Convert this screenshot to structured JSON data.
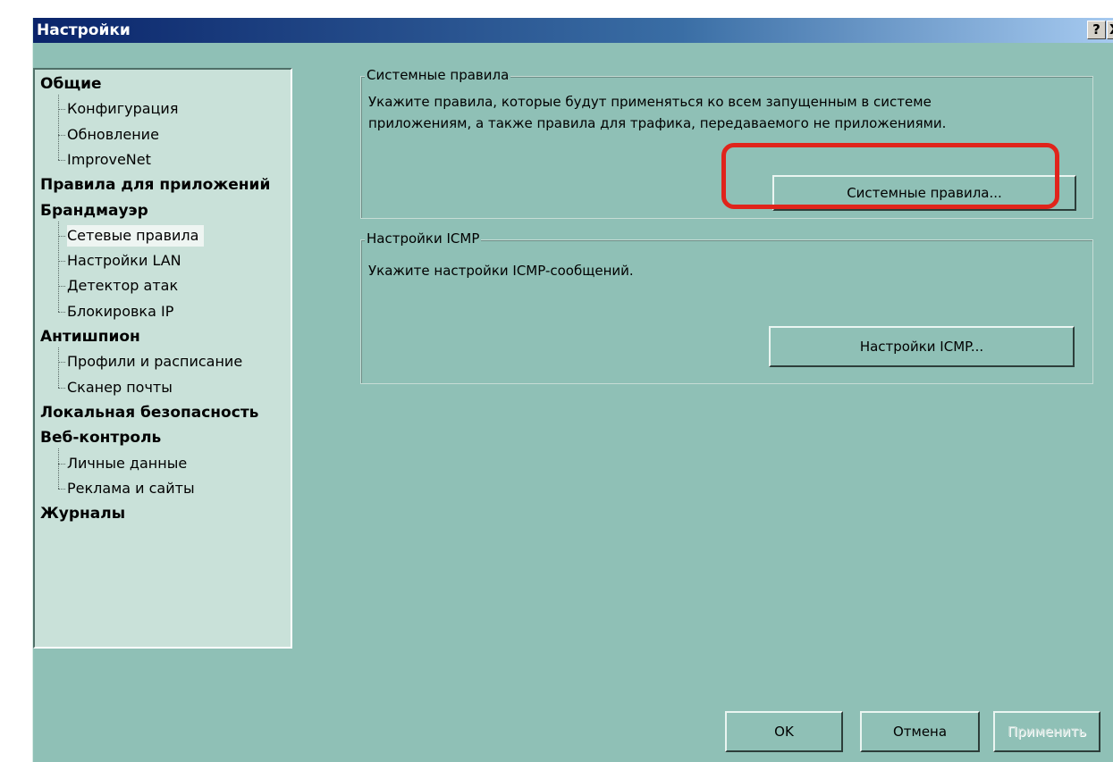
{
  "window": {
    "title": "Настройки",
    "help_glyph": "?",
    "close_glyph": "X"
  },
  "tree": {
    "items": [
      {
        "label": "Общие",
        "level": 0
      },
      {
        "label": "Конфигурация",
        "level": 1
      },
      {
        "label": "Обновление",
        "level": 1
      },
      {
        "label": "ImproveNet",
        "level": 1
      },
      {
        "label": "Правила для приложений",
        "level": 0
      },
      {
        "label": "Брандмауэр",
        "level": 0
      },
      {
        "label": "Сетевые правила",
        "level": 1,
        "selected": true
      },
      {
        "label": "Настройки LAN",
        "level": 1
      },
      {
        "label": "Детектор атак",
        "level": 1
      },
      {
        "label": "Блокировка IP",
        "level": 1
      },
      {
        "label": "Антишпион",
        "level": 0
      },
      {
        "label": "Профили и расписание",
        "level": 1
      },
      {
        "label": "Сканер почты",
        "level": 1
      },
      {
        "label": "Локальная безопасность",
        "level": 0
      },
      {
        "label": "Веб-контроль",
        "level": 0
      },
      {
        "label": "Личные данные",
        "level": 1
      },
      {
        "label": "Реклама и сайты",
        "level": 1
      },
      {
        "label": "Журналы",
        "level": 0
      }
    ]
  },
  "system_rules": {
    "legend": "Системные правила",
    "description_line1": "Укажите правила, которые будут применяться ко всем запущенным в системе",
    "description_line2": "приложениям, а также правила для трафика, передаваемого не приложениями.",
    "button_label": "Системные правила..."
  },
  "icmp": {
    "legend": "Настройки ICMP",
    "description": "Укажите настройки ICMP-сообщений.",
    "button_label": "Настройки ICMP..."
  },
  "footer": {
    "ok_label": "OK",
    "cancel_label": "Отмена",
    "apply_label": "Применить"
  },
  "colors": {
    "dialog_bg": "#8fc0b6",
    "tree_bg": "#c9e1d9",
    "title_bar": "#0a246a",
    "highlight": "#e0241b"
  }
}
